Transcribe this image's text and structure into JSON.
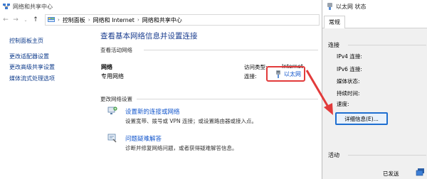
{
  "main_window": {
    "title": "网络和共享中心",
    "breadcrumb": [
      "控制面板",
      "网络和 Internet",
      "网络和共享中心"
    ]
  },
  "sidebar": {
    "items": [
      {
        "label": "控制面板主页"
      },
      {
        "label": "更改适配器设置"
      },
      {
        "label": "更改高级共享设置"
      },
      {
        "label": "媒体流式处理选项"
      }
    ]
  },
  "content": {
    "heading": "查看基本网络信息并设置连接",
    "active_networks_label": "查看活动网络",
    "network_name": "网络",
    "network_type": "专用网络",
    "access_type_label": "访问类型:",
    "access_type_value": "Internet",
    "connections_label": "连接:",
    "connection_value": "以太网",
    "change_settings_label": "更改网络设置",
    "tasks": [
      {
        "title": "设置新的连接或网络",
        "desc": "设置宽带、拨号或 VPN 连接；或设置路由器或接入点。"
      },
      {
        "title": "问题疑难解答",
        "desc": "诊断并修复网络问题，或者获得疑难解答信息。"
      }
    ]
  },
  "dialog": {
    "title": "以太网 状态",
    "tab": "常规",
    "connection_group": "连接",
    "fields": [
      "IPv4 连接:",
      "IPv6 连接:",
      "媒体状态:",
      "持续时间:",
      "速度:"
    ],
    "details_button": "详细信息(E)...",
    "activity_group": "活动",
    "sent_label": "已发送"
  },
  "colors": {
    "link": "#1155cc",
    "heading": "#1a3d8f",
    "annotation": "#e23b3b",
    "focus": "#1f6fd0"
  }
}
